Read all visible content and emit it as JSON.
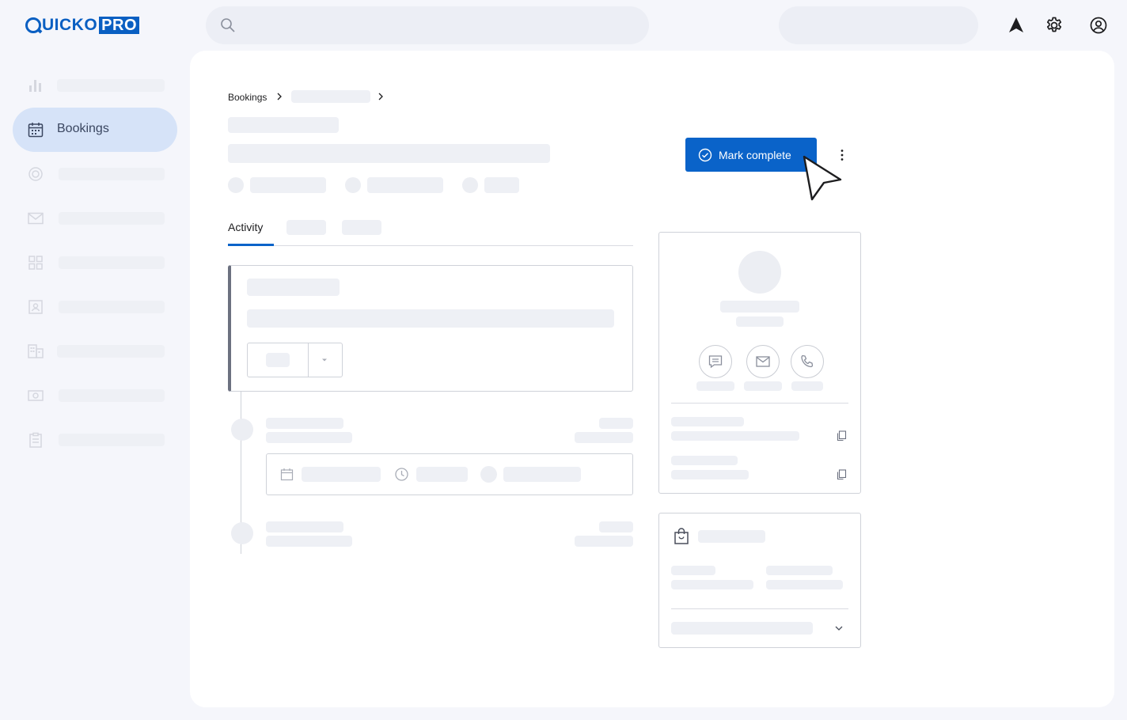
{
  "app": {
    "logo_prefix": "UICKO",
    "logo_suffix": "PRO"
  },
  "sidebar": {
    "active_item": {
      "label": "Bookings",
      "icon": "calendar-icon"
    }
  },
  "breadcrumb": {
    "root": "Bookings"
  },
  "actions": {
    "primary_label": "Mark complete"
  },
  "tabs": {
    "active_label": "Activity"
  },
  "colors": {
    "accent": "#0a63c9",
    "sidebar_active": "#d6e3f8"
  }
}
